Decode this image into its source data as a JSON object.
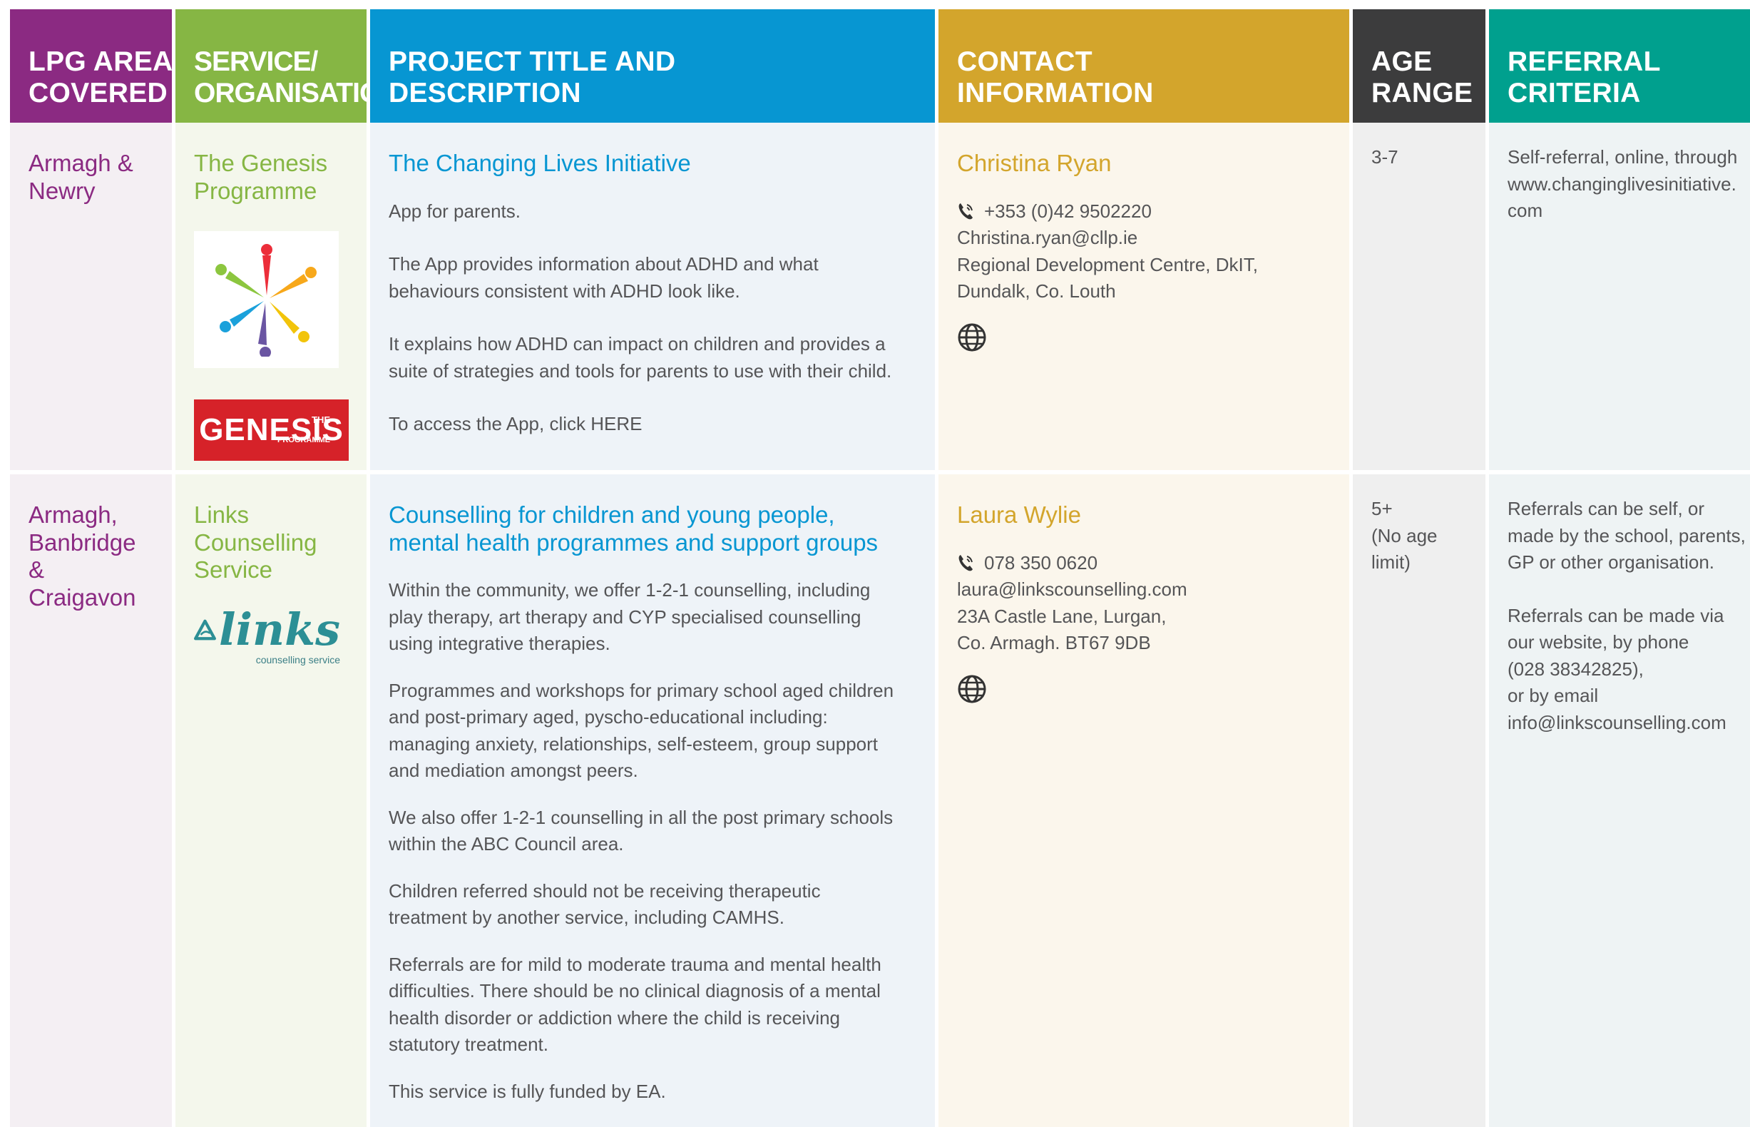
{
  "headers": {
    "lpg": [
      "LPG AREA",
      "COVERED"
    ],
    "service": [
      "SERVICE/",
      "ORGANISATION"
    ],
    "project": [
      "PROJECT TITLE AND",
      "DESCRIPTION"
    ],
    "contact": [
      "CONTACT",
      "INFORMATION"
    ],
    "age": [
      "AGE",
      "RANGE"
    ],
    "referral": [
      "REFERRAL",
      "CRITERIA"
    ]
  },
  "colors": {
    "lpg": "#8b2a82",
    "service": "#86b644",
    "project": "#0796d2",
    "contact": "#d3a52c",
    "age": "#3c3c3d",
    "referral": "#00a08e"
  },
  "rows": [
    {
      "area": [
        "Armagh &",
        "Newry"
      ],
      "organisation": [
        "The Genesis",
        "Programme"
      ],
      "logos": {
        "star_icon": "genesis-star-logo",
        "wordmark": {
          "the": "THE",
          "main": "GENESIS",
          "sub": "PROGRAMME"
        }
      },
      "project_title": [
        "The Changing Lives Initiative"
      ],
      "description": [
        [
          "App for parents."
        ],
        [
          "The App provides information about ADHD and what",
          "behaviours consistent with ADHD look like."
        ],
        [
          "It explains how ADHD can impact on children and provides a",
          "suite of strategies and tools for parents to use with their child."
        ],
        [
          "To access the App, click HERE"
        ]
      ],
      "contact": {
        "name": "Christina Ryan",
        "phone": "+353 (0)42 9502220",
        "lines": [
          "Christina.ryan@cllp.ie",
          "Regional Development Centre, DkIT,",
          "Dundalk, Co. Louth"
        ],
        "icons": [
          "phone-icon",
          "globe-icon"
        ]
      },
      "age_range": [
        "3-7"
      ],
      "referral": [
        [
          "Self-referral, online, through",
          "www.changinglivesinitiative.",
          "com"
        ]
      ]
    },
    {
      "area": [
        "Armagh,",
        "Banbridge",
        "& Craigavon"
      ],
      "organisation": [
        "Links",
        "Counselling",
        "Service"
      ],
      "logos": {
        "wordmark": {
          "main": "links",
          "sub": "counselling service"
        }
      },
      "project_title": [
        "Counselling for children and young people,",
        "mental health programmes and support groups"
      ],
      "description": [
        [
          "Within the community, we offer 1-2-1 counselling, including",
          "play therapy, art therapy and CYP specialised counselling",
          "using integrative therapies."
        ],
        [
          "Programmes and workshops for primary school aged children",
          "and post-primary aged, pyscho-educational including:",
          "managing anxiety, relationships, self-esteem, group support",
          "and mediation amongst peers."
        ],
        [
          "We also offer 1-2-1 counselling in all the post primary schools",
          "within the ABC Council area."
        ],
        [
          "Children referred should not be receiving therapeutic",
          "treatment by another service, including CAMHS."
        ],
        [
          "Referrals are for mild to moderate trauma and mental health",
          "difficulties. There should be no clinical diagnosis of a mental",
          "health disorder or addiction where the child is receiving",
          "statutory treatment."
        ],
        [
          "This service is fully funded by EA."
        ]
      ],
      "contact": {
        "name": "Laura Wylie",
        "phone": "078 350 0620",
        "lines": [
          "laura@linkscounselling.com",
          "23A Castle Lane, Lurgan,",
          "Co. Armagh. BT67 9DB"
        ],
        "icons": [
          "phone-icon",
          "globe-icon"
        ]
      },
      "age_range": [
        "5+",
        "(No age",
        "limit)"
      ],
      "referral": [
        [
          "Referrals can be self, or",
          "made by the school, parents,",
          "GP or other organisation."
        ],
        [
          "Referrals can be made via",
          "our website, by phone",
          "(028 38342825),",
          "or by email",
          "info@linkscounselling.com"
        ]
      ]
    }
  ]
}
